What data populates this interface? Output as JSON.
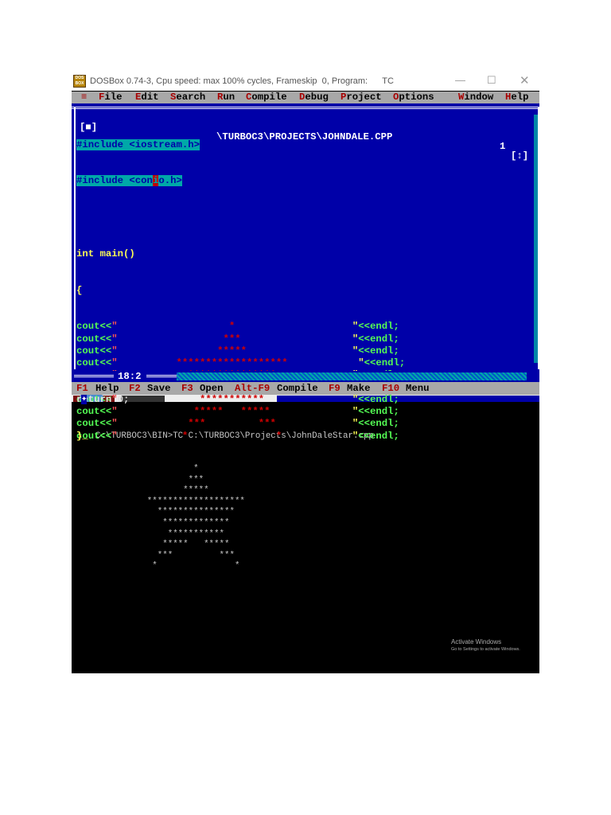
{
  "window": {
    "title": "DOSBox 0.74-3, Cpu speed: max 100% cycles, Frameskip  0, Program:      TC",
    "icon_text": "DOS BOX"
  },
  "menu": {
    "items": [
      {
        "hk": "F",
        "rest": "ile"
      },
      {
        "hk": "E",
        "rest": "dit"
      },
      {
        "hk": "S",
        "rest": "earch"
      },
      {
        "hk": "R",
        "rest": "un"
      },
      {
        "hk": "C",
        "rest": "ompile"
      },
      {
        "hk": "D",
        "rest": "ebug"
      },
      {
        "hk": "P",
        "rest": "roject"
      },
      {
        "hk": "O",
        "rest": "ptions"
      },
      {
        "hk": "W",
        "rest": "indow"
      },
      {
        "hk": "H",
        "rest": "elp"
      }
    ],
    "system": "≡"
  },
  "editor": {
    "file_path": "\\TURBOC3\\PROJECTS\\JOHNDALE.CPP",
    "window_number": "1",
    "close_box": "[■]",
    "zoom_box": "[↕]",
    "include1": "#include <iostream.h>",
    "include2_a": "#include <con",
    "include2_cursor": "i",
    "include2_b": "o.h>",
    "main_sig": "int main()",
    "open_brace": "{",
    "cout_prefix": "cout<<",
    "quote": "\"",
    "endl_suffix": "<<endl;",
    "star_rows": [
      "                   *                    ",
      "                  ***                   ",
      "                 *****                  ",
      "          *******************            ",
      "            ***************             ",
      "             *************              ",
      "              ***********               ",
      "             *****   *****              ",
      "            ***         ***             ",
      "           *               *            "
    ],
    "return_stmt": "return 0;",
    "close_brace": "}",
    "cursor_char": "_",
    "cursor_position": "18:2"
  },
  "helpbar": [
    {
      "key": "F1",
      "label": "Help"
    },
    {
      "key": "F2",
      "label": "Save"
    },
    {
      "key": "F3",
      "label": "Open"
    },
    {
      "key": "Alt-F9",
      "label": "Compile"
    },
    {
      "key": "F9",
      "label": "Make"
    },
    {
      "key": "F10",
      "label": "Menu"
    }
  ],
  "console": {
    "command": "C:\\TURBOC3\\BIN>TC C:\\TURBOC3\\Projects\\JohnDaleStar.cpp"
  },
  "watermark": {
    "title": "Activate Windows",
    "subtitle": "Go to Settings to activate Windows."
  }
}
